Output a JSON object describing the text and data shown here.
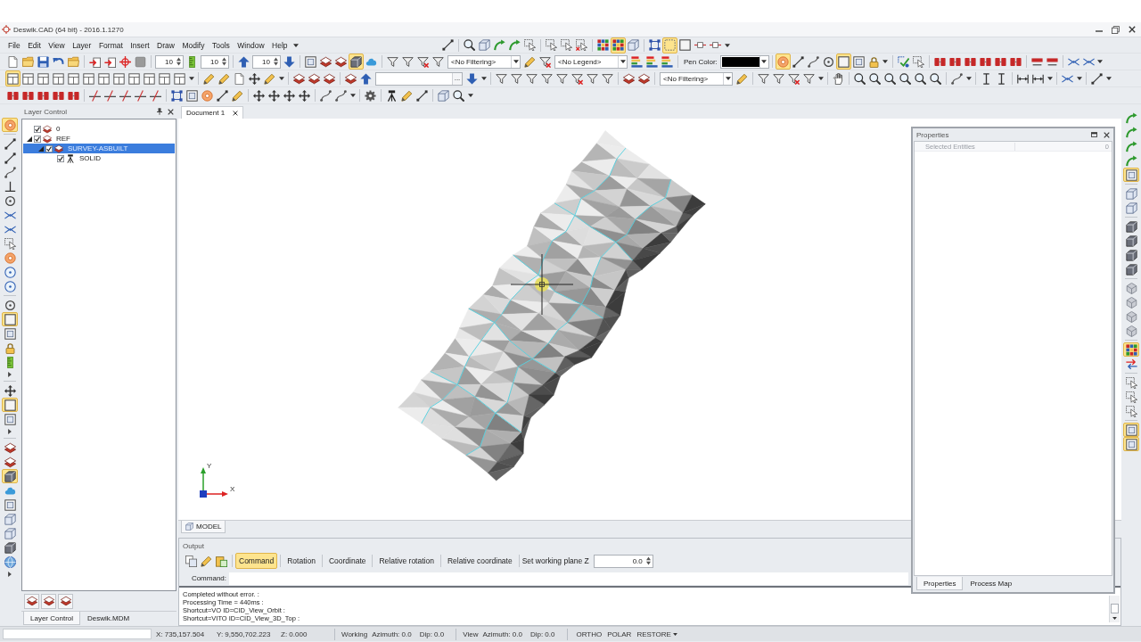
{
  "window": {
    "title": "Deswik.CAD (64 bit) - 2016.1.1270"
  },
  "menu": [
    {
      "label": "File"
    },
    {
      "label": "Edit"
    },
    {
      "label": "View"
    },
    {
      "label": "Layer"
    },
    {
      "label": "Format"
    },
    {
      "label": "Insert"
    },
    {
      "label": "Draw"
    },
    {
      "label": "Modify"
    },
    {
      "label": "Tools"
    },
    {
      "label": "Window"
    },
    {
      "label": "Help"
    }
  ],
  "toolbars": {
    "row_1": [
      {
        "kind": "button",
        "selected": false
      },
      {
        "kind": "separator"
      },
      {
        "kind": "button",
        "selected": false
      },
      {
        "kind": "button",
        "selected": false
      },
      {
        "kind": "button",
        "selected": false
      },
      {
        "kind": "button",
        "selected": false
      },
      {
        "kind": "button",
        "selected": false
      },
      {
        "kind": "separator"
      },
      {
        "kind": "button",
        "selected": false
      },
      {
        "kind": "button",
        "selected": false
      },
      {
        "kind": "button",
        "selected": false
      },
      {
        "kind": "separator"
      },
      {
        "kind": "button",
        "selected": false
      },
      {
        "kind": "button",
        "selected": true
      },
      {
        "kind": "button",
        "selected": false
      },
      {
        "kind": "separator"
      },
      {
        "kind": "button",
        "selected": false
      },
      {
        "kind": "button",
        "selected": true
      },
      {
        "kind": "button",
        "selected": false
      },
      {
        "kind": "button",
        "selected": false
      },
      {
        "kind": "button",
        "selected": false
      },
      {
        "kind": "overflow"
      }
    ],
    "row_2": [
      {
        "kind": "button",
        "selected": false
      },
      {
        "kind": "button",
        "selected": false
      },
      {
        "kind": "button",
        "selected": false
      },
      {
        "kind": "button",
        "selected": false
      },
      {
        "kind": "button",
        "selected": false
      },
      {
        "kind": "separator"
      },
      {
        "kind": "button",
        "selected": false
      },
      {
        "kind": "button",
        "selected": false
      },
      {
        "kind": "button",
        "selected": false
      },
      {
        "kind": "button",
        "selected": false
      },
      {
        "kind": "separator"
      },
      {
        "kind": "spin",
        "value": "10"
      },
      {
        "kind": "button",
        "selected": false
      },
      {
        "kind": "spin",
        "value": "10"
      },
      {
        "kind": "separator"
      },
      {
        "kind": "button",
        "selected": false
      },
      {
        "kind": "spin",
        "value": "10"
      },
      {
        "kind": "button",
        "selected": false
      },
      {
        "kind": "separator"
      },
      {
        "kind": "button",
        "selected": false
      },
      {
        "kind": "button",
        "selected": false
      },
      {
        "kind": "button",
        "selected": false
      },
      {
        "kind": "button",
        "selected": true
      },
      {
        "kind": "button",
        "selected": false
      },
      {
        "kind": "separator"
      },
      {
        "kind": "button",
        "selected": false
      },
      {
        "kind": "button",
        "selected": false
      },
      {
        "kind": "button",
        "selected": false
      },
      {
        "kind": "button",
        "selected": false
      },
      {
        "kind": "combo",
        "value": "<No Filtering>"
      },
      {
        "kind": "button",
        "selected": false
      },
      {
        "kind": "button",
        "selected": false
      },
      {
        "kind": "combo",
        "value": "<No Legend>"
      },
      {
        "kind": "button",
        "selected": false
      },
      {
        "kind": "button",
        "selected": false
      },
      {
        "kind": "button",
        "selected": false
      },
      {
        "kind": "separator"
      },
      {
        "kind": "label",
        "text": "Pen Color:"
      },
      {
        "kind": "swatch",
        "color": "#000000"
      },
      {
        "kind": "separator"
      },
      {
        "kind": "button",
        "selected": true
      },
      {
        "kind": "button",
        "selected": false
      },
      {
        "kind": "button",
        "selected": false
      },
      {
        "kind": "button",
        "selected": false
      },
      {
        "kind": "button",
        "selected": true
      },
      {
        "kind": "button",
        "selected": false
      },
      {
        "kind": "button",
        "selected": false
      },
      {
        "kind": "overflow"
      },
      {
        "kind": "separator"
      },
      {
        "kind": "button",
        "selected": false
      },
      {
        "kind": "button",
        "selected": false
      },
      {
        "kind": "separator"
      },
      {
        "kind": "button",
        "selected": false
      },
      {
        "kind": "button",
        "selected": false
      },
      {
        "kind": "button",
        "selected": false
      },
      {
        "kind": "button",
        "selected": false
      },
      {
        "kind": "button",
        "selected": false
      },
      {
        "kind": "button",
        "selected": false
      },
      {
        "kind": "separator"
      },
      {
        "kind": "button",
        "selected": false
      },
      {
        "kind": "button",
        "selected": false
      },
      {
        "kind": "separator"
      },
      {
        "kind": "button",
        "selected": false
      },
      {
        "kind": "button",
        "selected": false
      },
      {
        "kind": "overflow"
      }
    ],
    "row_3": [
      {
        "kind": "button",
        "selected": true
      },
      {
        "kind": "button",
        "selected": false
      },
      {
        "kind": "button",
        "selected": false
      },
      {
        "kind": "button",
        "selected": false
      },
      {
        "kind": "button",
        "selected": false
      },
      {
        "kind": "button",
        "selected": false
      },
      {
        "kind": "button",
        "selected": false
      },
      {
        "kind": "button",
        "selected": false
      },
      {
        "kind": "button",
        "selected": false
      },
      {
        "kind": "button",
        "selected": false
      },
      {
        "kind": "button",
        "selected": false
      },
      {
        "kind": "button",
        "selected": false
      },
      {
        "kind": "overflow"
      },
      {
        "kind": "separator"
      },
      {
        "kind": "button",
        "selected": false
      },
      {
        "kind": "button",
        "selected": false
      },
      {
        "kind": "button",
        "selected": false
      },
      {
        "kind": "button",
        "selected": false
      },
      {
        "kind": "button",
        "selected": false
      },
      {
        "kind": "overflow"
      },
      {
        "kind": "separator"
      },
      {
        "kind": "button",
        "selected": false
      },
      {
        "kind": "button",
        "selected": false
      },
      {
        "kind": "button",
        "selected": false
      },
      {
        "kind": "separator"
      },
      {
        "kind": "button",
        "selected": false
      },
      {
        "kind": "button",
        "selected": false
      },
      {
        "kind": "combo",
        "browse": "..."
      },
      {
        "kind": "button",
        "selected": false
      },
      {
        "kind": "overflow"
      },
      {
        "kind": "separator"
      },
      {
        "kind": "button",
        "selected": false
      },
      {
        "kind": "button",
        "selected": false
      },
      {
        "kind": "button",
        "selected": false
      },
      {
        "kind": "button",
        "selected": false
      },
      {
        "kind": "button",
        "selected": false
      },
      {
        "kind": "button",
        "selected": false
      },
      {
        "kind": "button",
        "selected": false
      },
      {
        "kind": "button",
        "selected": false
      },
      {
        "kind": "separator"
      },
      {
        "kind": "button",
        "selected": false
      },
      {
        "kind": "button",
        "selected": false
      },
      {
        "kind": "separator"
      },
      {
        "kind": "combo",
        "value": "<No Filtering>"
      },
      {
        "kind": "button",
        "selected": false
      },
      {
        "kind": "separator"
      },
      {
        "kind": "button",
        "selected": false
      },
      {
        "kind": "button",
        "selected": false
      },
      {
        "kind": "button",
        "selected": false
      },
      {
        "kind": "button",
        "selected": false
      },
      {
        "kind": "overflow"
      },
      {
        "kind": "separator"
      },
      {
        "kind": "button",
        "selected": false
      },
      {
        "kind": "separator"
      },
      {
        "kind": "button",
        "selected": false
      },
      {
        "kind": "button",
        "selected": false
      },
      {
        "kind": "button",
        "selected": false
      },
      {
        "kind": "button",
        "selected": false
      },
      {
        "kind": "button",
        "selected": false
      },
      {
        "kind": "button",
        "selected": false
      },
      {
        "kind": "separator"
      },
      {
        "kind": "button",
        "selected": false
      },
      {
        "kind": "overflow"
      },
      {
        "kind": "separator"
      },
      {
        "kind": "button",
        "selected": false
      },
      {
        "kind": "button",
        "selected": false
      },
      {
        "kind": "separator"
      },
      {
        "kind": "button",
        "selected": false
      },
      {
        "kind": "button",
        "selected": false
      },
      {
        "kind": "overflow"
      },
      {
        "kind": "separator"
      },
      {
        "kind": "button",
        "selected": false
      },
      {
        "kind": "overflow"
      },
      {
        "kind": "separator"
      },
      {
        "kind": "button",
        "selected": false
      },
      {
        "kind": "overflow"
      }
    ],
    "row_4": [
      {
        "kind": "button",
        "selected": false
      },
      {
        "kind": "button",
        "selected": false
      },
      {
        "kind": "button",
        "selected": false
      },
      {
        "kind": "button",
        "selected": false
      },
      {
        "kind": "button",
        "selected": false
      },
      {
        "kind": "separator"
      },
      {
        "kind": "button",
        "selected": false
      },
      {
        "kind": "button",
        "selected": false
      },
      {
        "kind": "button",
        "selected": false
      },
      {
        "kind": "button",
        "selected": false
      },
      {
        "kind": "button",
        "selected": false
      },
      {
        "kind": "separator"
      },
      {
        "kind": "button",
        "selected": false
      },
      {
        "kind": "button",
        "selected": false
      },
      {
        "kind": "button",
        "selected": false
      },
      {
        "kind": "button",
        "selected": false
      },
      {
        "kind": "button",
        "selected": false
      },
      {
        "kind": "separator"
      },
      {
        "kind": "button",
        "selected": false
      },
      {
        "kind": "button",
        "selected": false
      },
      {
        "kind": "button",
        "selected": false
      },
      {
        "kind": "button",
        "selected": false
      },
      {
        "kind": "separator"
      },
      {
        "kind": "button",
        "selected": false
      },
      {
        "kind": "button",
        "selected": false
      },
      {
        "kind": "overflow"
      },
      {
        "kind": "separator"
      },
      {
        "kind": "button",
        "selected": false
      },
      {
        "kind": "separator"
      },
      {
        "kind": "button",
        "selected": false
      },
      {
        "kind": "button",
        "selected": false
      },
      {
        "kind": "button",
        "selected": false
      },
      {
        "kind": "separator"
      },
      {
        "kind": "button",
        "selected": false
      },
      {
        "kind": "button",
        "selected": false
      },
      {
        "kind": "overflow"
      }
    ],
    "left": [
      {
        "kind": "button",
        "selected": true
      },
      {
        "kind": "separator"
      },
      {
        "kind": "button",
        "selected": false
      },
      {
        "kind": "button",
        "selected": false
      },
      {
        "kind": "button",
        "selected": false
      },
      {
        "kind": "button",
        "selected": false
      },
      {
        "kind": "button",
        "selected": false
      },
      {
        "kind": "button",
        "selected": false
      },
      {
        "kind": "button",
        "selected": false
      },
      {
        "kind": "button",
        "selected": false
      },
      {
        "kind": "button",
        "selected": false
      },
      {
        "kind": "button",
        "selected": false
      },
      {
        "kind": "button",
        "selected": false
      },
      {
        "kind": "separator"
      },
      {
        "kind": "button",
        "selected": false
      },
      {
        "kind": "button",
        "selected": true
      },
      {
        "kind": "button",
        "selected": false
      },
      {
        "kind": "button",
        "selected": false
      },
      {
        "kind": "button",
        "selected": false
      },
      {
        "kind": "overflow"
      },
      {
        "kind": "separator"
      },
      {
        "kind": "button",
        "selected": false
      },
      {
        "kind": "button",
        "selected": true
      },
      {
        "kind": "button",
        "selected": false
      },
      {
        "kind": "overflow"
      },
      {
        "kind": "separator"
      },
      {
        "kind": "button",
        "selected": false
      },
      {
        "kind": "button",
        "selected": false
      },
      {
        "kind": "button",
        "selected": true
      },
      {
        "kind": "button",
        "selected": false
      },
      {
        "kind": "button",
        "selected": false
      },
      {
        "kind": "button",
        "selected": false
      },
      {
        "kind": "button",
        "selected": false
      },
      {
        "kind": "button",
        "selected": false
      },
      {
        "kind": "button",
        "selected": false
      },
      {
        "kind": "overflow"
      }
    ],
    "right": [
      {
        "kind": "button",
        "selected": false
      },
      {
        "kind": "button",
        "selected": false
      },
      {
        "kind": "button",
        "selected": false
      },
      {
        "kind": "button",
        "selected": false
      },
      {
        "kind": "button",
        "selected": true
      },
      {
        "kind": "separator"
      },
      {
        "kind": "button",
        "selected": false
      },
      {
        "kind": "button",
        "selected": false
      },
      {
        "kind": "separator"
      },
      {
        "kind": "button",
        "selected": false
      },
      {
        "kind": "button",
        "selected": false
      },
      {
        "kind": "button",
        "selected": false
      },
      {
        "kind": "button",
        "selected": false
      },
      {
        "kind": "separator"
      },
      {
        "kind": "button",
        "selected": false
      },
      {
        "kind": "button",
        "selected": false
      },
      {
        "kind": "button",
        "selected": false
      },
      {
        "kind": "button",
        "selected": false
      },
      {
        "kind": "separator"
      },
      {
        "kind": "button",
        "selected": true
      },
      {
        "kind": "button",
        "selected": false
      },
      {
        "kind": "separator"
      },
      {
        "kind": "button",
        "selected": false
      },
      {
        "kind": "button",
        "selected": false
      },
      {
        "kind": "button",
        "selected": false
      },
      {
        "kind": "separator"
      },
      {
        "kind": "button",
        "selected": true
      },
      {
        "kind": "button",
        "selected": true
      }
    ]
  },
  "layer_control": {
    "title": "Layer Control",
    "tree": [
      {
        "label": "0",
        "kind": "layer",
        "checked": true,
        "selected": false
      },
      {
        "label": "REF",
        "kind": "layer",
        "checked": true,
        "expanded": true,
        "selected": false,
        "children": [
          {
            "label": "SURVEY-ASBUILT",
            "kind": "layer",
            "checked": true,
            "expanded": true,
            "selected": true,
            "children": [
              {
                "label": "SOLID",
                "kind": "object",
                "checked": true,
                "selected": false
              }
            ]
          }
        ]
      }
    ],
    "tabs": [
      {
        "label": "Layer Control",
        "selected": true
      },
      {
        "label": "Deswik.MDM",
        "selected": false
      }
    ]
  },
  "document": {
    "tabs": [
      {
        "label": "Document 1",
        "selected": true
      }
    ],
    "axes": {
      "y": "Y",
      "x": "X"
    },
    "model_tabs": [
      {
        "label": "MODEL",
        "selected": true
      }
    ]
  },
  "output": {
    "title": "Output",
    "modes": [
      {
        "label": "Command",
        "selected": true
      },
      {
        "label": "Rotation",
        "selected": false
      },
      {
        "label": "Coordinate",
        "selected": false
      },
      {
        "label": "Relative rotation",
        "selected": false
      },
      {
        "label": "Relative coordinate",
        "selected": false
      }
    ],
    "working_plane": {
      "label": "Set working plane Z",
      "value": "0.0"
    },
    "command": {
      "label": "Command:"
    },
    "log": [
      "Completed without error. :",
      "Processing Time = 440ms :",
      "Shortcut=VO ID=CID_View_Orbit :",
      "Shortcut=VITO ID=CID_View_3D_Top :"
    ]
  },
  "properties": {
    "title": "Properties",
    "rows": [
      {
        "name": "Selected Entities",
        "value": "0"
      }
    ],
    "tabs": [
      {
        "label": "Properties",
        "selected": true
      },
      {
        "label": "Process Map",
        "selected": false
      }
    ]
  },
  "status_bar": {
    "coordinates": [
      "X: 735,157.504",
      "Y: 9,550,702.223",
      "Z: 0.000"
    ],
    "working": {
      "label": "Working",
      "azimuth": "Azimuth: 0.0",
      "dip": "Dip: 0.0"
    },
    "view": {
      "label": "View",
      "azimuth": "Azimuth: 0.0",
      "dip": "Dip: 0.0"
    },
    "modes": [
      {
        "label": "ORTHO",
        "dropdown": false
      },
      {
        "label": "POLAR",
        "dropdown": false
      },
      {
        "label": "RESTORE",
        "dropdown": true
      }
    ]
  }
}
